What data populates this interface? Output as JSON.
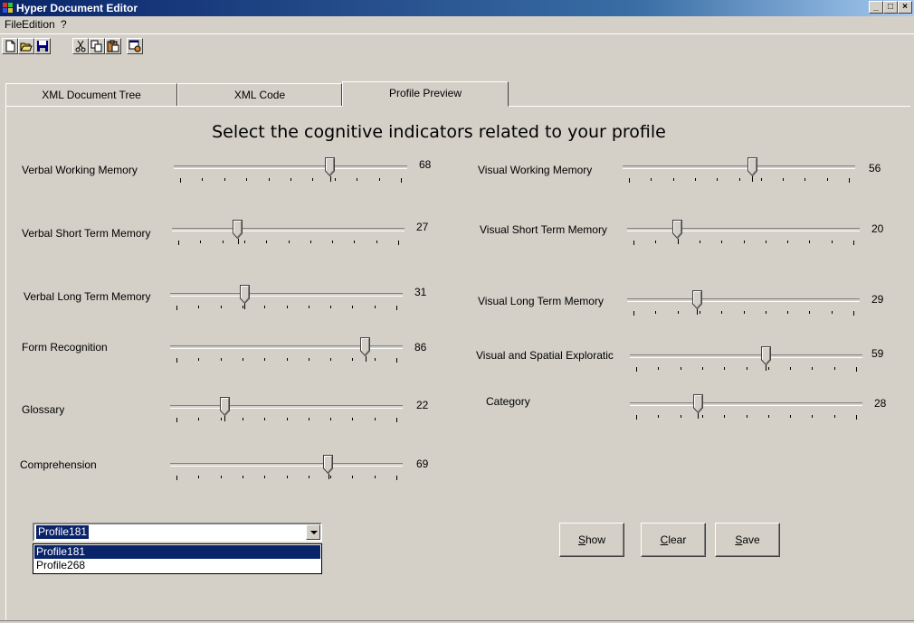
{
  "window": {
    "title": "Hyper Document Editor",
    "controls": [
      "_",
      "□",
      "×"
    ]
  },
  "menu": [
    "File",
    "Edition",
    "?"
  ],
  "toolbar": {
    "icons": [
      "new-file-icon",
      "open-folder-icon",
      "save-icon",
      "cut-icon",
      "copy-icon",
      "paste-icon",
      "preview-icon"
    ]
  },
  "tabs": [
    {
      "label": "XML Document Tree"
    },
    {
      "label": "XML Code"
    },
    {
      "label": "Profile Preview",
      "active": true
    }
  ],
  "heading": "Select the cognitive indicators related to your profile",
  "sliders_left": [
    {
      "label": "Verbal Working Memory",
      "value": "68",
      "level": 68
    },
    {
      "label": "Verbal Short Term Memory",
      "value": "27",
      "level": 27
    },
    {
      "label": "Verbal Long Term Memory",
      "value": "31",
      "level": 31
    },
    {
      "label": "Form Recognition",
      "value": "86",
      "level": 86
    },
    {
      "label": "Glossary",
      "value": "22",
      "level": 22
    },
    {
      "label": "Comprehension",
      "value": "69",
      "level": 69
    }
  ],
  "sliders_right": [
    {
      "label": "Visual Working Memory",
      "value": "56",
      "level": 56
    },
    {
      "label": "Visual Short Term Memory",
      "value": "20",
      "level": 20
    },
    {
      "label": "Visual Long Term Memory",
      "value": "29",
      "level": 29
    },
    {
      "label": "Visual and Spatial Exploratic",
      "value": "59",
      "level": 59
    },
    {
      "label": "Category",
      "value": "28",
      "level": 28
    }
  ],
  "profile_select": {
    "value": "Profile181",
    "options": [
      "Profile181",
      "Profile268"
    ],
    "selected_index": 0
  },
  "buttons": {
    "show": {
      "accel": "S",
      "rest": "how"
    },
    "clear": {
      "accel": "C",
      "rest": "lear"
    },
    "save": {
      "accel": "S",
      "rest": "ave"
    }
  }
}
